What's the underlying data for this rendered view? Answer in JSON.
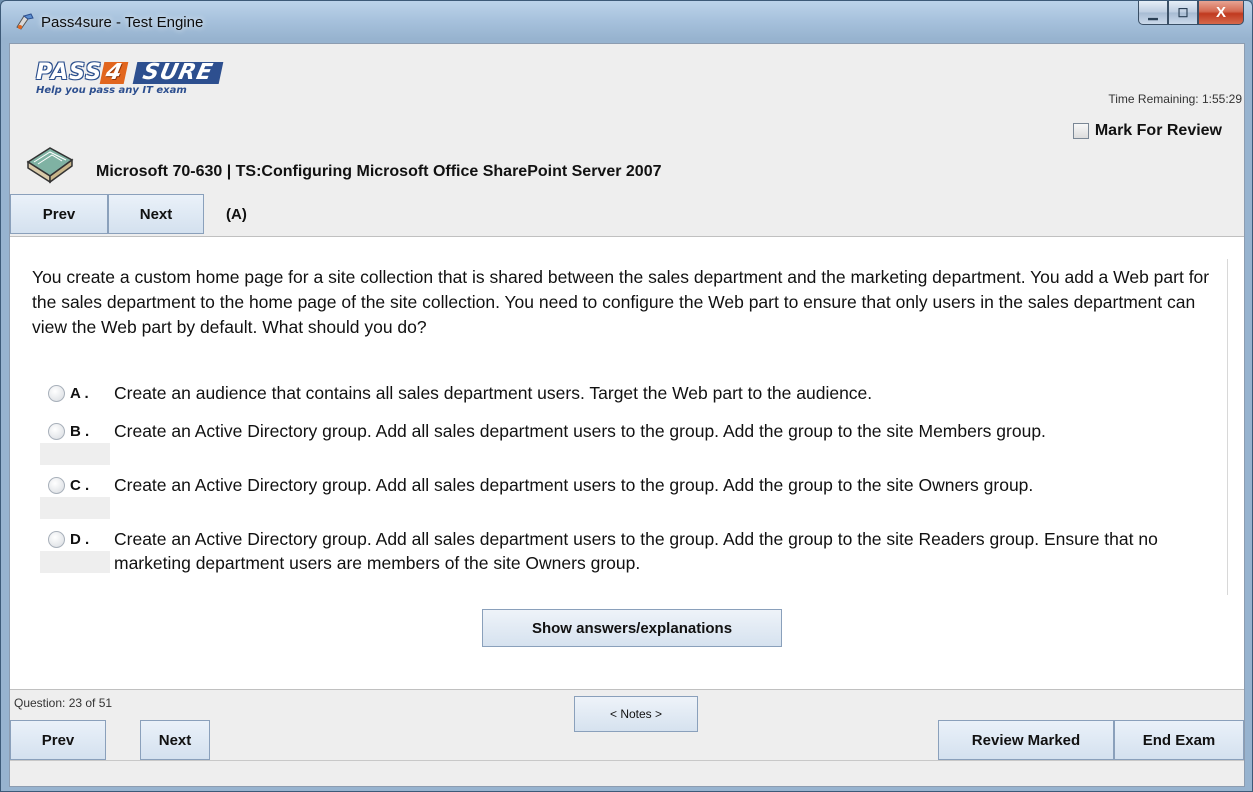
{
  "window": {
    "title": "Pass4sure - Test Engine",
    "minimize_glyph": "▁",
    "maximize_glyph": "☐",
    "close_glyph": "X"
  },
  "logo": {
    "pass": "PASS",
    "four": "4",
    "sure": "SURE",
    "tagline": "Help you pass any IT exam"
  },
  "header": {
    "time_remaining": "Time Remaining: 1:55:29",
    "mark_for_review": "Mark For Review",
    "exam_title": "Microsoft 70-630 | TS:Configuring Microsoft Office SharePoint Server 2007"
  },
  "top_nav": {
    "prev": "Prev",
    "next": "Next",
    "answer_indicator": "(A)"
  },
  "question": {
    "text": "You create a custom home page for a site collection that is shared between the sales department and the marketing department.   You add a Web part for the sales department to the home page of the site collection.   You need to configure the Web part to ensure that only users in the sales department can view the Web part by default.   What should you do?",
    "options": [
      {
        "letter": "A .",
        "text": "Create an audience that contains all sales department users. Target the Web part to the audience."
      },
      {
        "letter": "B .",
        "text": "Create an Active Directory group. Add all sales department users to the group. Add the group to the site Members group."
      },
      {
        "letter": "C .",
        "text": "Create an Active Directory group. Add all sales department users to the group. Add the group to the site Owners group."
      },
      {
        "letter": "D .",
        "text": "Create an Active Directory group. Add all sales department users to the group. Add the group to the site Readers group. Ensure that no marketing department users are members of the site Owners group."
      }
    ],
    "show_answers": "Show answers/explanations"
  },
  "footer": {
    "question_count": "Question: 23 of 51",
    "notes": "< Notes >",
    "prev": "Prev",
    "next": "Next",
    "review_marked": "Review Marked",
    "end_exam": "End Exam"
  },
  "colors": {
    "title_gradient_top": "#bcd3ea",
    "button_face": "#d4e1ef",
    "content_bg": "#ffffff",
    "panel_bg": "#eeeeee",
    "logo_blue": "#2d4f8f",
    "logo_orange": "#e2661e"
  },
  "icons": {
    "title": "pass4sure-app-icon",
    "exam": "book-icon"
  }
}
